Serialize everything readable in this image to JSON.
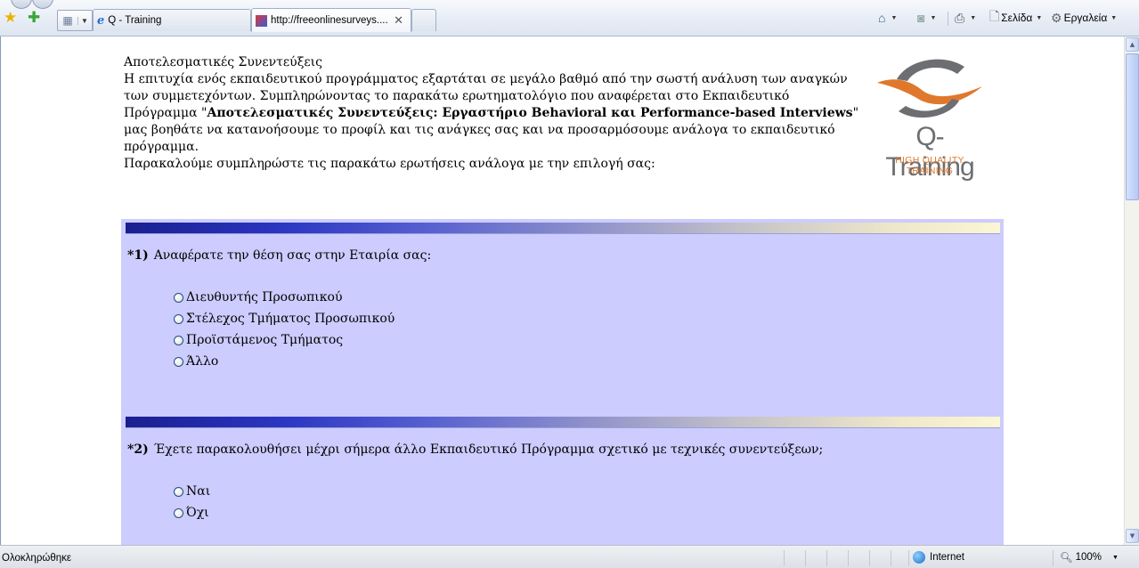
{
  "browser": {
    "tabs": [
      {
        "label": "Q - Training"
      },
      {
        "label": "http://freeonlinesurveys...."
      }
    ],
    "commands": {
      "page": "Σελίδα",
      "tools": "Εργαλεία"
    }
  },
  "intro": {
    "heading": "Αποτελεσματικές Συνεντεύξεις",
    "para1_a": "Η επιτυχία ενός εκπαιδευτικού προγράμματος εξαρτάται σε μεγάλο βαθμό από την σωστή ανάλυση των αναγκών των συμμετεχόντων. Συμπληρώνοντας το παρακάτω ερωτηματολόγιο  που αναφέρεται στο Εκπαιδευτικό Πρόγραμμα \"",
    "para1_bold": "Αποτελεσματικές Συνεντεύξεις: Εργαστήριο Behavioral και Performance-based Interviews",
    "para1_b": "\" μας βοηθάτε να κατανοήσουμε το προφίλ και τις ανάγκες σας και να προσαρμόσουμε ανάλογα το εκπαιδευτικό πρόγραμμα.",
    "para2": "Παρακαλούμε συμπληρώστε τις παρακάτω ερωτήσεις ανάλογα με την επιλογή σας:"
  },
  "logo": {
    "name": "Q-Training",
    "tagline": "HIGH QUALITY TRAINING"
  },
  "questions": [
    {
      "number": "*1)",
      "text": "Αναφέρατε την θέση σας στην Εταιρία σας:",
      "options": [
        "Διευθυντής Προσωπικού",
        "Στέλεχος Τμήματος Προσωπικού",
        "Προϊστάμενος Τμήματος",
        "Άλλο"
      ]
    },
    {
      "number": "*2)",
      "text": "Έχετε παρακολουθήσει μέχρι σήμερα άλλο Εκπαιδευτικό Πρόγραμμα σχετικό με τεχνικές συνεντεύξεων;",
      "options": [
        "Ναι",
        "Όχι"
      ]
    }
  ],
  "status": {
    "text": "Ολοκληρώθηκε",
    "zone": "Internet",
    "zoom": "100%"
  },
  "colors": {
    "panel_bg": "#ccccfe",
    "logo_orange": "#e0782b",
    "logo_gray": "#6d6e71"
  }
}
